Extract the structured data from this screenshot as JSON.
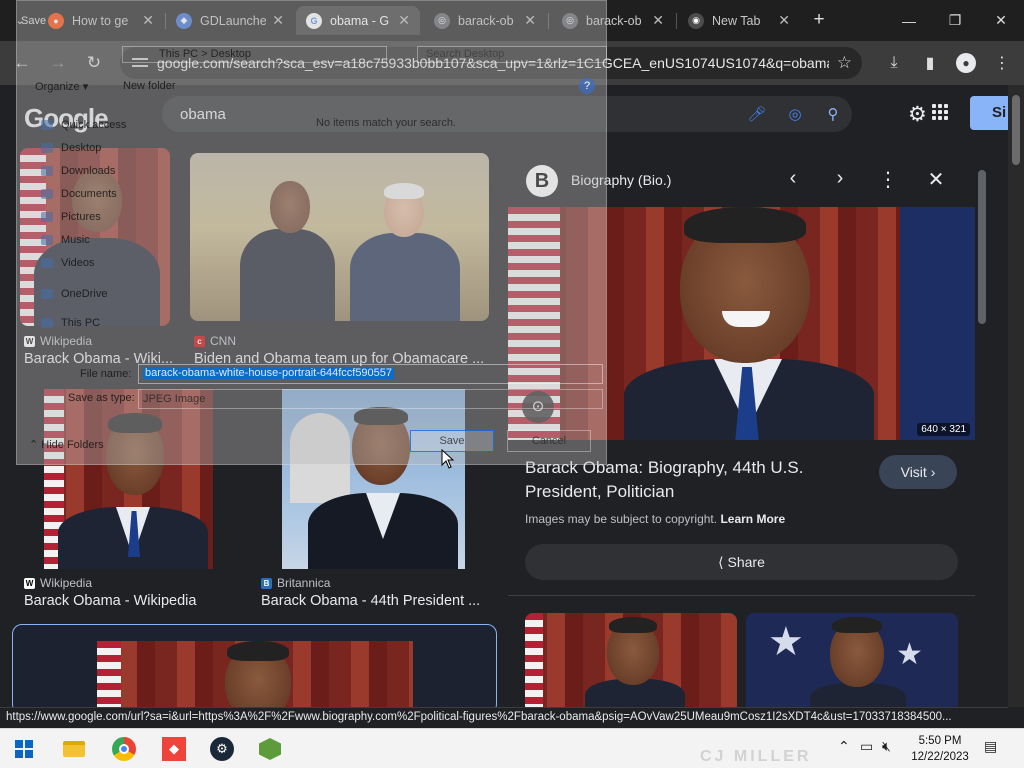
{
  "tabs": [
    {
      "title": "How to ge",
      "favicon": "reddit-icon",
      "active": false
    },
    {
      "title": "GDLaunche",
      "favicon": "gdlauncher-icon",
      "active": false
    },
    {
      "title": "obama - G",
      "favicon": "google-icon",
      "active": true
    },
    {
      "title": "barack-ob",
      "favicon": "globe-icon",
      "active": false
    },
    {
      "title": "barack-ob",
      "favicon": "globe-icon",
      "active": false
    },
    {
      "title": "New Tab",
      "favicon": "chrome-icon",
      "active": false
    }
  ],
  "toolbar": {
    "url": "google.com/search?sca_esv=a18c75933b0bb107&sca_upv=1&rlz=1C1GCEA_enUS1074US1074&q=obama..."
  },
  "search": {
    "logo": "Google",
    "query": "obama",
    "signin_label": "Si"
  },
  "results": [
    {
      "source": "Wikipedia",
      "title": "Barack Obama - Wiki..."
    },
    {
      "source": "CNN",
      "title": "Biden and Obama team up for Obamacare ..."
    },
    {
      "source": "Wikipedia",
      "title": "Barack Obama - Wikipedia"
    },
    {
      "source": "Britannica",
      "title": "Barack Obama - 44th President ..."
    }
  ],
  "panel": {
    "publisher_initial": "B",
    "publisher": "Biography (Bio.)",
    "dimensions": "640 × 321",
    "title": "Barack Obama: Biography, 44th U.S. President, Politician",
    "visit_label": "Visit",
    "copyright": "Images may be subject to copyright.",
    "learn_more": "Learn More",
    "share_label": "Share"
  },
  "status_url": "https://www.google.com/url?sa=i&url=https%3A%2F%2Fwww.biography.com%2Fpolitical-figures%2Fbarack-obama&psig=AOvVaw25UMeau9mCosz1I2sXDT4c&ust=17033718384500...",
  "dialog": {
    "title": "Save",
    "path": "This PC   >   Desktop",
    "search_placeholder": "Search Desktop",
    "organize": "Organize ▾",
    "new_folder": "New folder",
    "nav_items": [
      "Quick access",
      "Desktop",
      "Downloads",
      "Documents",
      "Pictures",
      "Music",
      "Videos",
      "OneDrive",
      "This PC"
    ],
    "empty_message": "No items match your search.",
    "file_name_label": "File name:",
    "file_name": "barack-obama-white-house-portrait-644fccf590557",
    "save_type_label": "Save as type:",
    "save_type": "JPEG Image",
    "hide_folders": "Hide Folders",
    "save_label": "Save",
    "cancel_label": "Cancel"
  },
  "taskbar": {
    "time": "5:50 PM",
    "date": "12/22/2023",
    "watermark": "CJ MILLER"
  }
}
